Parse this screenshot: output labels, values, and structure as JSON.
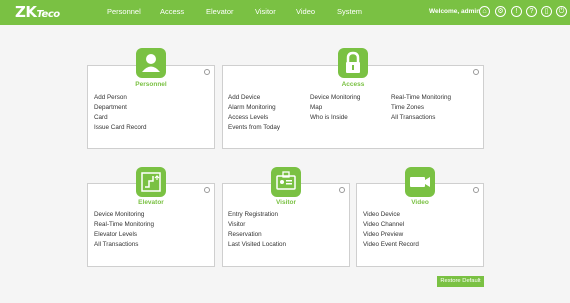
{
  "header": {
    "logo_main": "ZK",
    "logo_small": "Teco",
    "nav": [
      "Personnel",
      "Access",
      "Elevator",
      "Visitor",
      "Video",
      "System"
    ],
    "welcome": "Welcome, admin"
  },
  "personnel": {
    "title": "Personnel",
    "links": [
      "Add Person",
      "Department",
      "Card",
      "Issue Card Record"
    ]
  },
  "access": {
    "title": "Access",
    "col1": [
      "Add Device",
      "Alarm Monitoring",
      "Access Levels",
      "Events from Today"
    ],
    "col2": [
      "Device Monitoring",
      "Map",
      "Who is Inside"
    ],
    "col3": [
      "Real-Time Monitoring",
      "Time Zones",
      "All Transactions"
    ]
  },
  "elevator": {
    "title": "Elevator",
    "links": [
      "Device Monitoring",
      "Real-Time Monitoring",
      "Elevator Levels",
      "All Transactions"
    ]
  },
  "visitor": {
    "title": "Visitor",
    "links": [
      "Entry Registration",
      "Visitor",
      "Reservation",
      "Last Visited Location"
    ]
  },
  "video": {
    "title": "Video",
    "links": [
      "Video Device",
      "Video Channel",
      "Video Preview",
      "Video Event Record"
    ]
  },
  "restore_label": "Restore Default",
  "colors": {
    "brand": "#7ac143"
  },
  "icons": [
    "home-icon",
    "gear-icon",
    "info-icon",
    "help-icon",
    "lock-icon",
    "power-icon"
  ]
}
